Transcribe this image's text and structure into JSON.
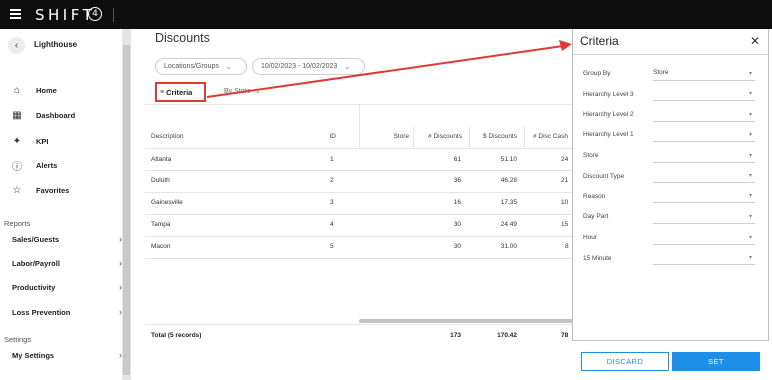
{
  "app": {
    "logo": "SHIFT",
    "logo_badge": "4"
  },
  "sidebar": {
    "site_name": "Lighthouse",
    "nav": [
      {
        "label": "Home",
        "icon": "home-icon"
      },
      {
        "label": "Dashboard",
        "icon": "dashboard-icon"
      },
      {
        "label": "KPI",
        "icon": "sparkle-icon"
      },
      {
        "label": "Alerts",
        "icon": "alert-icon"
      },
      {
        "label": "Favorites",
        "icon": "star-icon"
      }
    ],
    "reports_title": "Reports",
    "reports": [
      {
        "label": "Sales/Guests"
      },
      {
        "label": "Labor/Payroll"
      },
      {
        "label": "Productivity"
      },
      {
        "label": "Loss Prevention"
      }
    ],
    "settings_title": "Settings",
    "settings": [
      {
        "label": "My Settings"
      }
    ]
  },
  "main": {
    "title": "Discounts",
    "filters": {
      "locations": "Locations/Groups",
      "date_range": "10/02/2023 - 10/02/2023"
    },
    "criteria_label": "Criteria",
    "group_by_label": "By Store",
    "table": {
      "columns": [
        "Description",
        "ID",
        "Store",
        "# Discounts",
        "$ Discounts",
        "# Disc Cash"
      ],
      "rows": [
        {
          "description": "Atlanta",
          "id": "1",
          "discounts_count": "61",
          "discounts_amount": "51.10",
          "disc_cash": "24"
        },
        {
          "description": "Duluth",
          "id": "2",
          "discounts_count": "36",
          "discounts_amount": "46.28",
          "disc_cash": "21"
        },
        {
          "description": "Gainesville",
          "id": "3",
          "discounts_count": "16",
          "discounts_amount": "17.35",
          "disc_cash": "10"
        },
        {
          "description": "Tampa",
          "id": "4",
          "discounts_count": "30",
          "discounts_amount": "24.49",
          "disc_cash": "15"
        },
        {
          "description": "Macon",
          "id": "5",
          "discounts_count": "30",
          "discounts_amount": "31.00",
          "disc_cash": "8"
        }
      ],
      "total": {
        "label": "Total (5 records)",
        "discounts_count": "173",
        "discounts_amount": "170.42",
        "disc_cash": "78"
      }
    }
  },
  "criteria_panel": {
    "title": "Criteria",
    "close_icon": "close-icon",
    "fields": [
      {
        "label": "Group By",
        "value": "Store"
      },
      {
        "label": "Hierarchy Level 3",
        "value": ""
      },
      {
        "label": "Hierarchy Level 2",
        "value": ""
      },
      {
        "label": "Hierarchy Level 1",
        "value": ""
      },
      {
        "label": "Store",
        "value": ""
      },
      {
        "label": "Discount Type",
        "value": ""
      },
      {
        "label": "Reason",
        "value": ""
      },
      {
        "label": "Day Part",
        "value": ""
      },
      {
        "label": "Hour",
        "value": ""
      },
      {
        "label": "15 Minute",
        "value": ""
      }
    ],
    "discard_label": "DISCARD",
    "set_label": "SET"
  },
  "colors": {
    "topbar": "#0d0d0d",
    "highlight": "#e03a35",
    "primary": "#1e8fe8"
  }
}
